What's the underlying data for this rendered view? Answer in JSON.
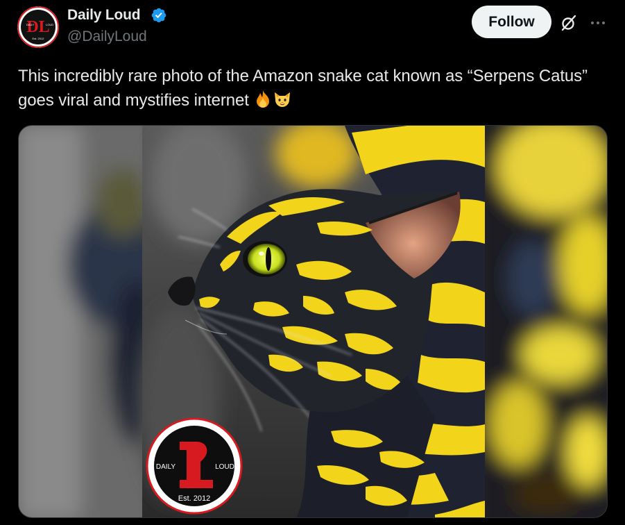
{
  "post": {
    "author": {
      "display_name": "Daily Loud",
      "handle": "@DailyLoud",
      "verified": true,
      "avatar_icon": "daily-loud-logo"
    },
    "actions": {
      "follow_label": "Follow",
      "grok_icon": "grok-icon",
      "more_icon": "more-horizontal-icon"
    },
    "text": "This incredibly rare photo of the Amazon snake cat known as “Serpens Catus” goes viral and mystifies internet",
    "emojis": [
      "fire",
      "cat-face"
    ],
    "media": {
      "alt": "",
      "watermark": {
        "left": "DAILY",
        "right": "LOUD",
        "est": "Est. 2012"
      }
    }
  },
  "colors": {
    "background": "#000000",
    "text": "#e7e9ea",
    "secondary": "#71767b",
    "verified": "#1d9bf0",
    "brand_red": "#d71920",
    "follow_bg": "#eff3f4"
  }
}
